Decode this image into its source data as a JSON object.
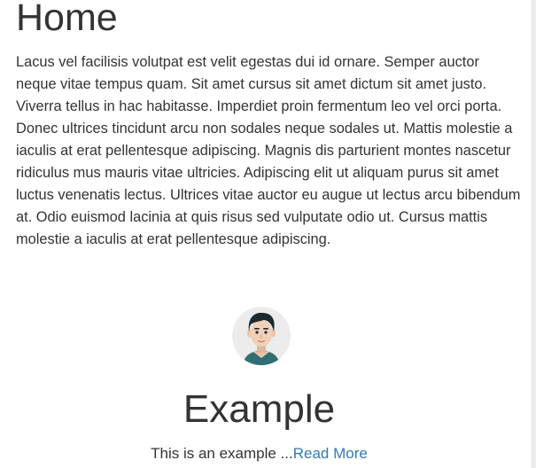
{
  "page": {
    "title": "Home",
    "body": "Lacus vel facilisis volutpat est velit egestas dui id ornare. Semper auctor neque vitae tempus quam. Sit amet cursus sit amet dictum sit amet justo. Viverra tellus in hac habitasse. Imperdiet proin fermentum leo vel orci porta. Donec ultrices tincidunt arcu non sodales neque sodales ut. Mattis molestie a iaculis at erat pellentesque adipiscing. Magnis dis parturient montes nascetur ridiculus mus mauris vitae ultricies. Adipiscing elit ut aliquam purus sit amet luctus venenatis lectus. Ultrices vitae auctor eu augue ut lectus arcu bibendum at. Odio euismod lacinia at quis risus sed vulputate odio ut. Cursus mattis molestie a iaculis at erat pellentesque adipiscing."
  },
  "card": {
    "avatar_icon": "user-avatar-icon",
    "title": "Example",
    "text": "This is an example ...",
    "link_label": "Read More"
  },
  "colors": {
    "text": "#333333",
    "link": "#337ab7",
    "avatar_bg": "#ececec"
  }
}
